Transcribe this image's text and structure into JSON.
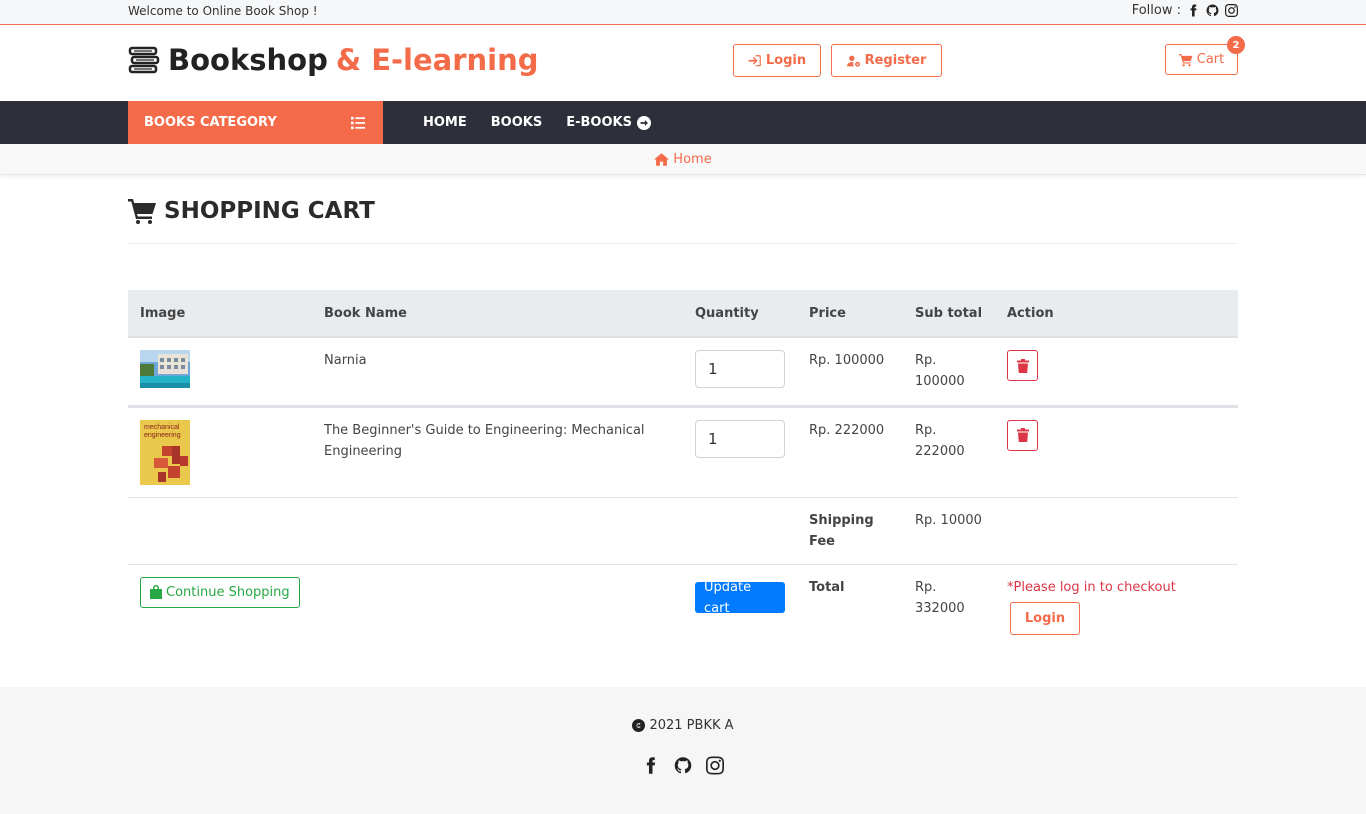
{
  "topbar": {
    "welcome": "Welcome to Online Book Shop !",
    "follow": "Follow :"
  },
  "brand": {
    "name": "Bookshop",
    "accent": "& E-learning",
    "icon": "books-icon"
  },
  "header": {
    "login": "Login",
    "register": "Register",
    "cart": "Cart",
    "cart_count": "2"
  },
  "nav": {
    "category": "BOOKS CATEGORY",
    "home": "HOME",
    "books": "BOOKS",
    "ebooks": "E-BOOKS"
  },
  "breadcrumb": {
    "home": "Home"
  },
  "page": {
    "title": "SHOPPING CART"
  },
  "cart": {
    "headers": [
      "Image",
      "Book Name",
      "Quantity",
      "Price",
      "Sub total",
      "Action"
    ],
    "items": [
      {
        "name": "Narnia",
        "qty": "1",
        "price": "Rp. 100000",
        "subtotal": "Rp. 100000"
      },
      {
        "name": "The Beginner's Guide to Engineering: Mechanical Engineering",
        "qty": "1",
        "price": "Rp. 222000",
        "subtotal": "Rp. 222000",
        "cover_text": "mechanical engineering"
      }
    ],
    "shipping_label": "Shipping Fee",
    "shipping_value": "Rp. 10000",
    "total_label": "Total",
    "total_value": "Rp. 332000",
    "continue": "Continue Shopping",
    "update": "Update cart",
    "checkout_warning": "*Please log in to checkout",
    "login": "Login"
  },
  "footer": {
    "copyright": "2021 PBKK A"
  },
  "colors": {
    "accent": "#f46b4a",
    "nav": "#2d2f3a",
    "danger": "#dc3545",
    "success": "#28a745",
    "primary": "#007bff"
  }
}
